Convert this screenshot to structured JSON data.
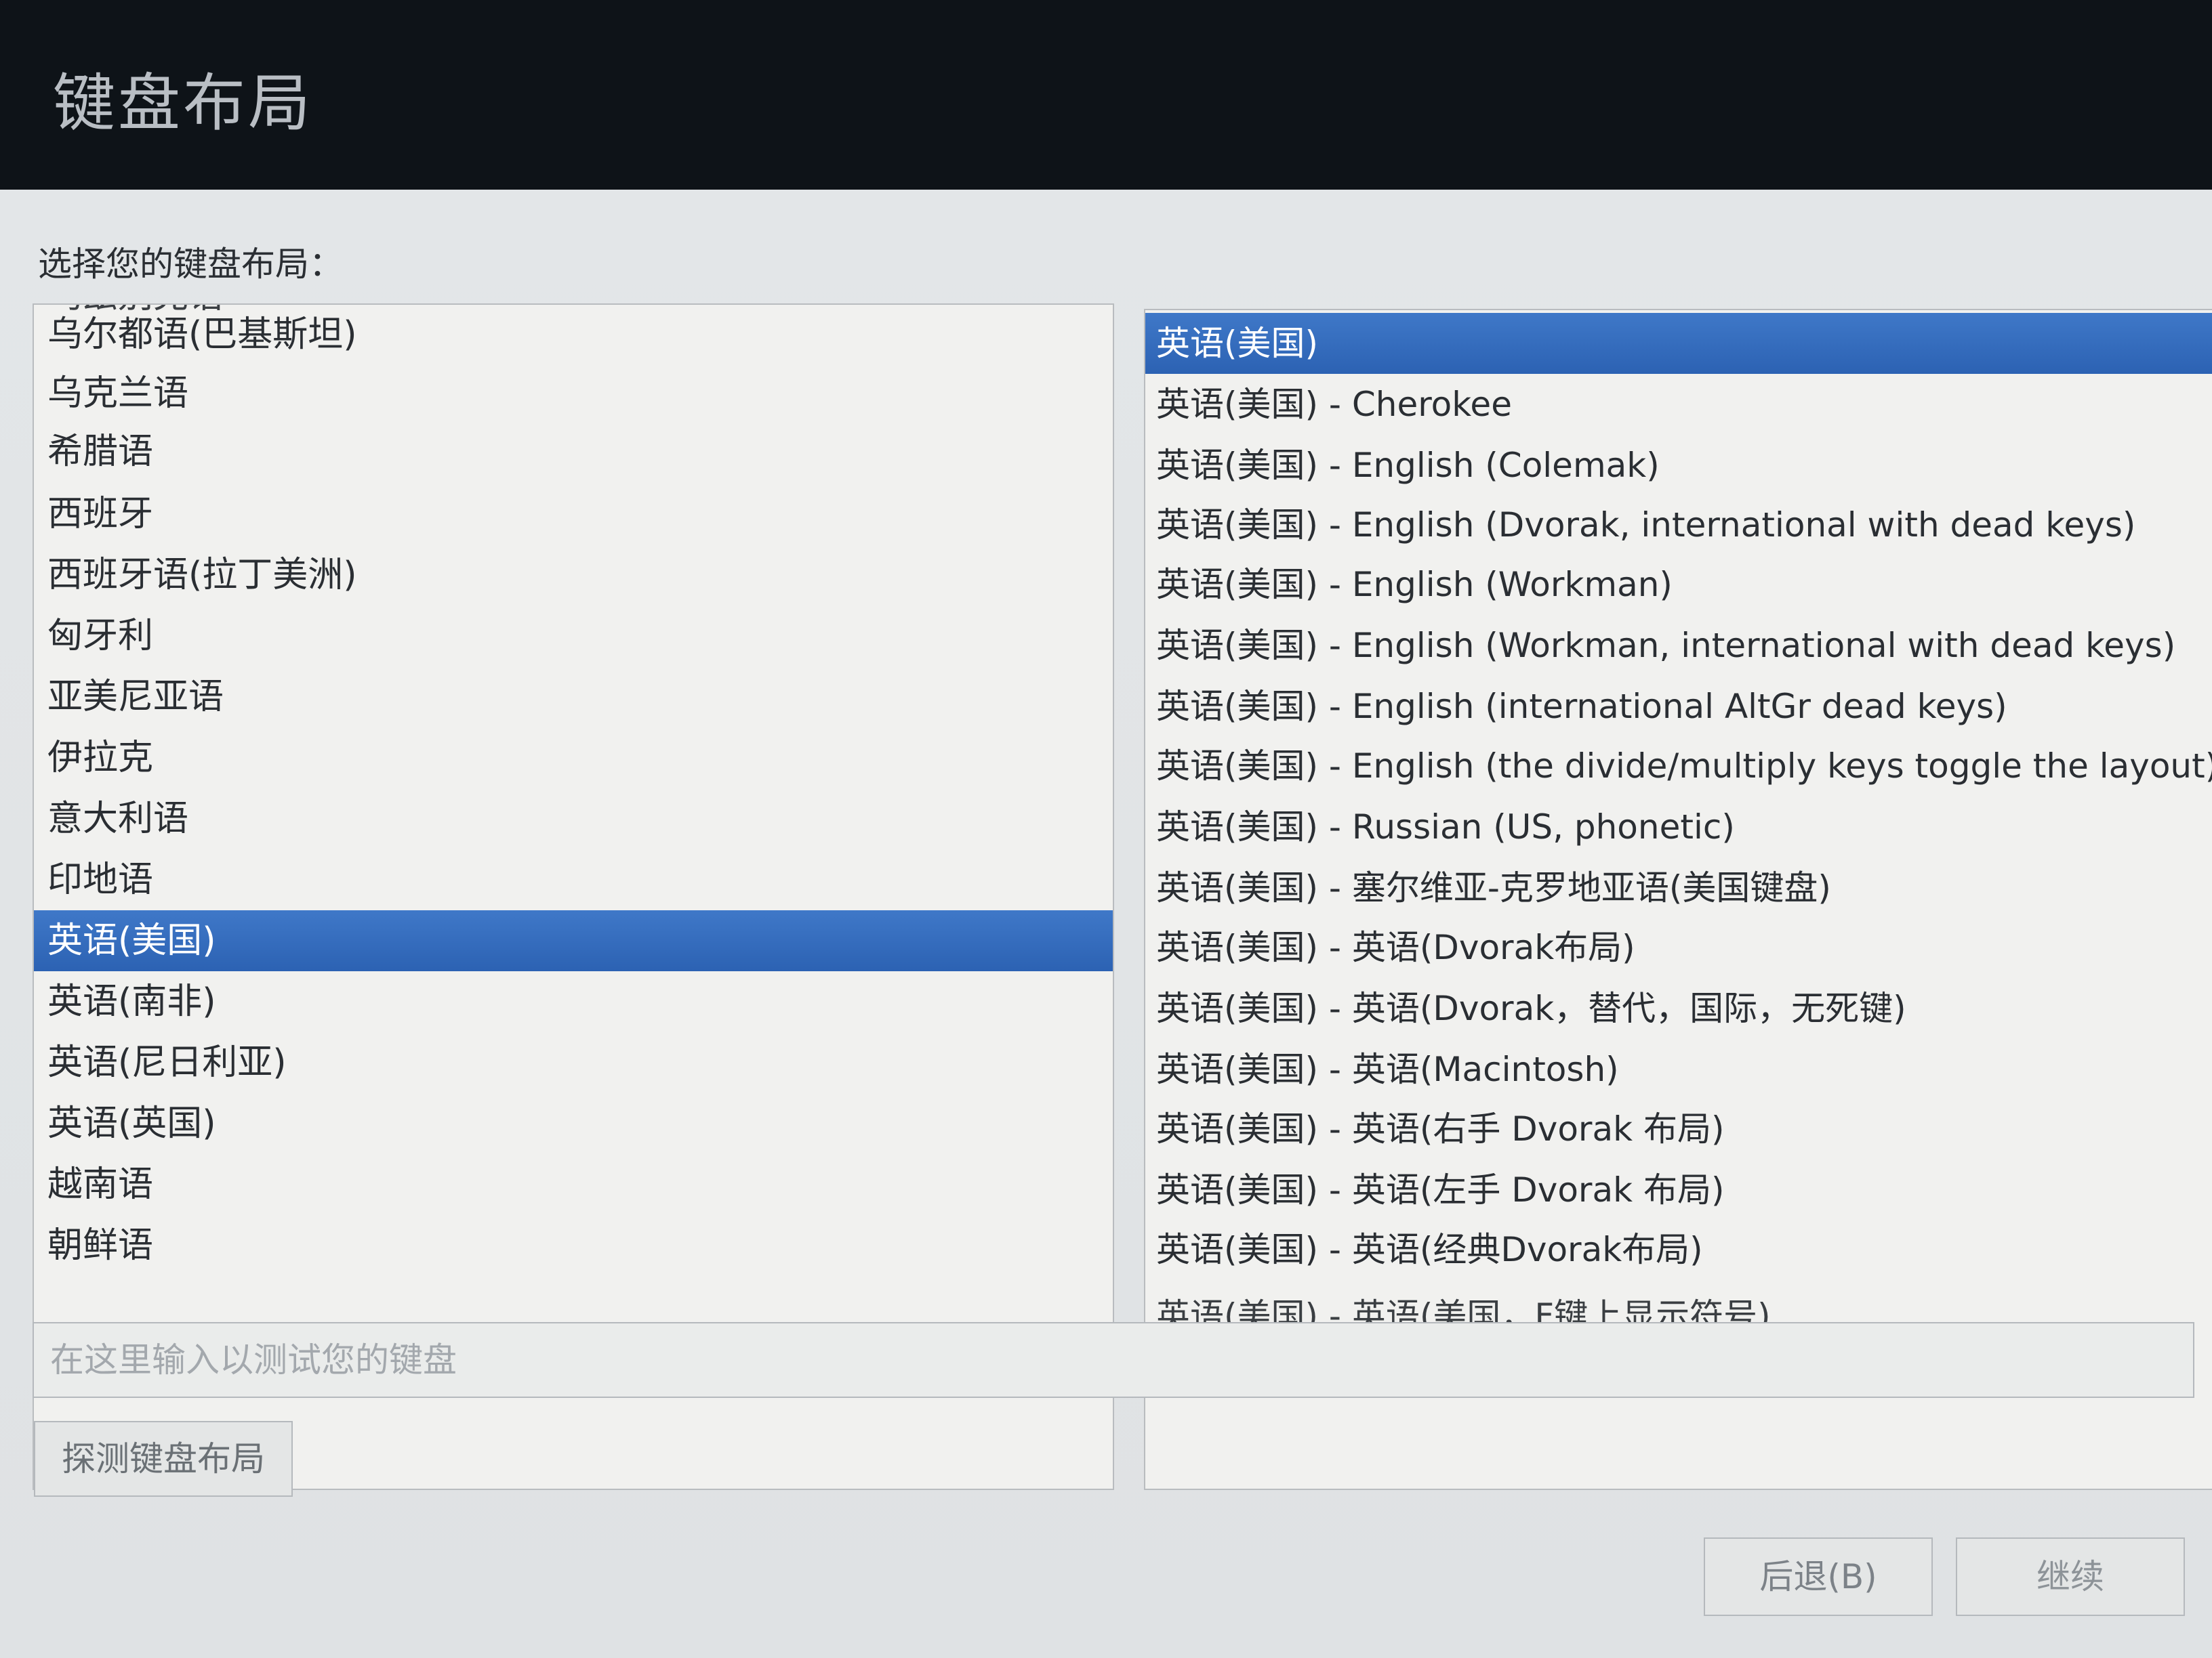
{
  "window": {
    "title": "键盘布局"
  },
  "prompt": "选择您的键盘布局：",
  "left_list": {
    "items": [
      {
        "label": "乌兹别克语",
        "state": "partial"
      },
      {
        "label": "乌尔都语(巴基斯坦)"
      },
      {
        "label": "乌克兰语"
      },
      {
        "label": "希腊语"
      },
      {
        "label": "西班牙"
      },
      {
        "label": "西班牙语(拉丁美洲)"
      },
      {
        "label": "匈牙利"
      },
      {
        "label": "亚美尼亚语"
      },
      {
        "label": "伊拉克"
      },
      {
        "label": "意大利语"
      },
      {
        "label": "印地语"
      },
      {
        "label": "英语(美国)",
        "state": "selected"
      },
      {
        "label": "英语(南非)"
      },
      {
        "label": "英语(尼日利亚)"
      },
      {
        "label": "英语(英国)"
      },
      {
        "label": "越南语"
      },
      {
        "label": "朝鲜语"
      }
    ]
  },
  "right_list": {
    "items": [
      {
        "label": "英语(美国)",
        "state": "selected"
      },
      {
        "label": "英语(美国) - Cherokee"
      },
      {
        "label": "英语(美国) - English (Colemak)"
      },
      {
        "label": "英语(美国) - English (Dvorak, international with dead keys)"
      },
      {
        "label": "英语(美国) - English (Workman)"
      },
      {
        "label": "英语(美国) - English (Workman, international with dead keys)"
      },
      {
        "label": "英语(美国) - English (international AltGr dead keys)"
      },
      {
        "label": "英语(美国) - English (the divide/multiply keys toggle the layout)"
      },
      {
        "label": "英语(美国) - Russian (US, phonetic)"
      },
      {
        "label": "英语(美国) - 塞尔维亚-克罗地亚语(美国键盘)"
      },
      {
        "label": "英语(美国) - 英语(Dvorak布局)"
      },
      {
        "label": "英语(美国) - 英语(Dvorak，替代，国际，无死键)"
      },
      {
        "label": "英语(美国) - 英语(Macintosh)"
      },
      {
        "label": "英语(美国) - 英语(右手 Dvorak 布局)"
      },
      {
        "label": "英语(美国) - 英语(左手 Dvorak 布局)"
      },
      {
        "label": "英语(美国) - 英语(经典Dvorak布局)"
      },
      {
        "label": "英语(美国) - 英语(美国，F键上显示符号)",
        "state": "partial"
      }
    ]
  },
  "test_input": {
    "placeholder": "在这里输入以测试您的键盘",
    "value": ""
  },
  "buttons": {
    "detect": "探测键盘布局",
    "back": "后退(B)",
    "continue": "继续"
  },
  "colors": {
    "selection": "#2c62b3",
    "header_bg": "#0e1318"
  }
}
